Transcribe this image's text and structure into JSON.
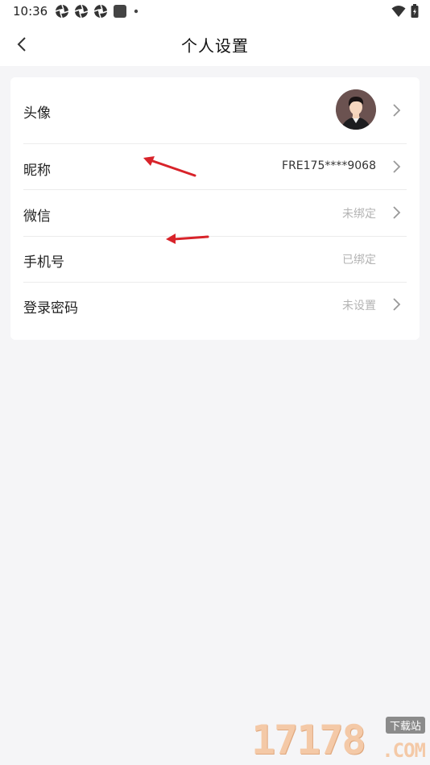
{
  "status_bar": {
    "time": "10:36",
    "icons": [
      "aperture-icon",
      "aperture-icon",
      "aperture-icon",
      "square-app-icon",
      "dot-icon"
    ],
    "right_icons": [
      "wifi-icon",
      "battery-charging-icon"
    ]
  },
  "navbar": {
    "back_icon": "chevron-left-icon",
    "title": "个人设置"
  },
  "settings": {
    "rows": [
      {
        "label": "头像",
        "value": "",
        "has_chevron": true,
        "type": "avatar"
      },
      {
        "label": "昵称",
        "value": "FRE175****9068",
        "has_chevron": true
      },
      {
        "label": "微信",
        "value": "未绑定",
        "has_chevron": true
      },
      {
        "label": "手机号",
        "value": "已绑定",
        "has_chevron": false
      },
      {
        "label": "登录密码",
        "value": "未设置",
        "has_chevron": true
      }
    ]
  },
  "watermark": {
    "digits": "17178",
    "tag": "下载站",
    "domain": ".COM"
  },
  "colors": {
    "background": "#f5f5f7",
    "card": "#ffffff",
    "muted_text": "#b3b3b3",
    "annotation_arrow": "#d8232a"
  }
}
